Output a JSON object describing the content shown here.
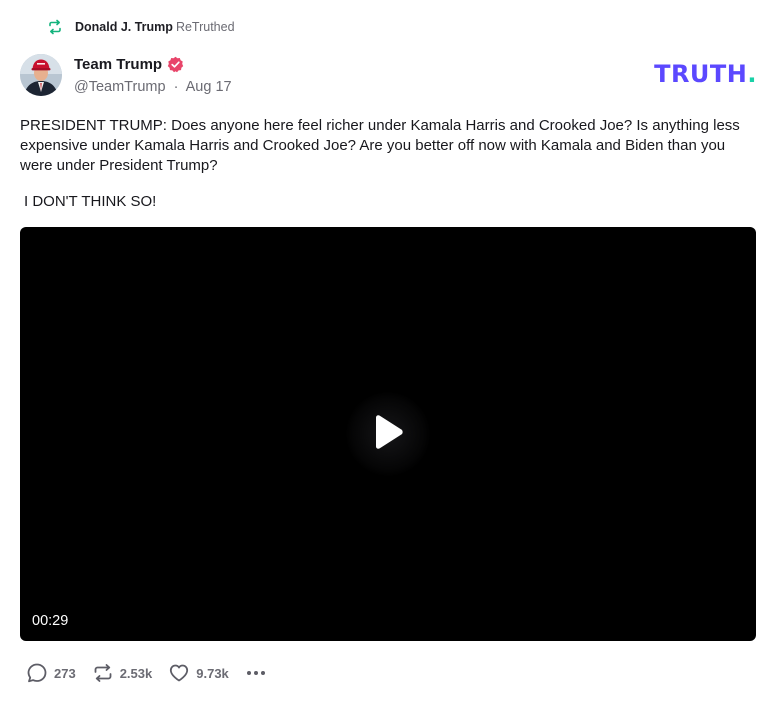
{
  "retruth": {
    "name": "Donald J. Trump",
    "label": "ReTruthed",
    "icon": "retruth-icon"
  },
  "author": {
    "name": "Team Trump",
    "handle": "@TeamTrump",
    "separator": "·",
    "date": "Aug 17",
    "verified_icon": "verified-badge-icon"
  },
  "brand": {
    "logo_text": "TRUTH",
    "logo_dot": ".",
    "color": "#5b48ff",
    "dot_color": "#19d1a7"
  },
  "post": {
    "text": "PRESIDENT TRUMP: Does anyone here feel richer under Kamala Harris and Crooked Joe? Is anything less expensive under Kamala Harris and Crooked Joe? Are you better off now with Kamala and Biden than you were under President Trump?",
    "text2": "I DON'T THINK SO!"
  },
  "video": {
    "duration": "00:29",
    "play_icon": "play-icon"
  },
  "actions": {
    "replies": "273",
    "retruths": "2.53k",
    "likes": "9.73k",
    "reply_icon": "comment-icon",
    "retruth_icon": "retruth-icon",
    "like_icon": "heart-icon",
    "more_icon": "more-dots-icon"
  },
  "colors": {
    "retruth_green": "#14b37d",
    "verified_pink": "#e8456a",
    "muted_text": "#6b6b73"
  }
}
